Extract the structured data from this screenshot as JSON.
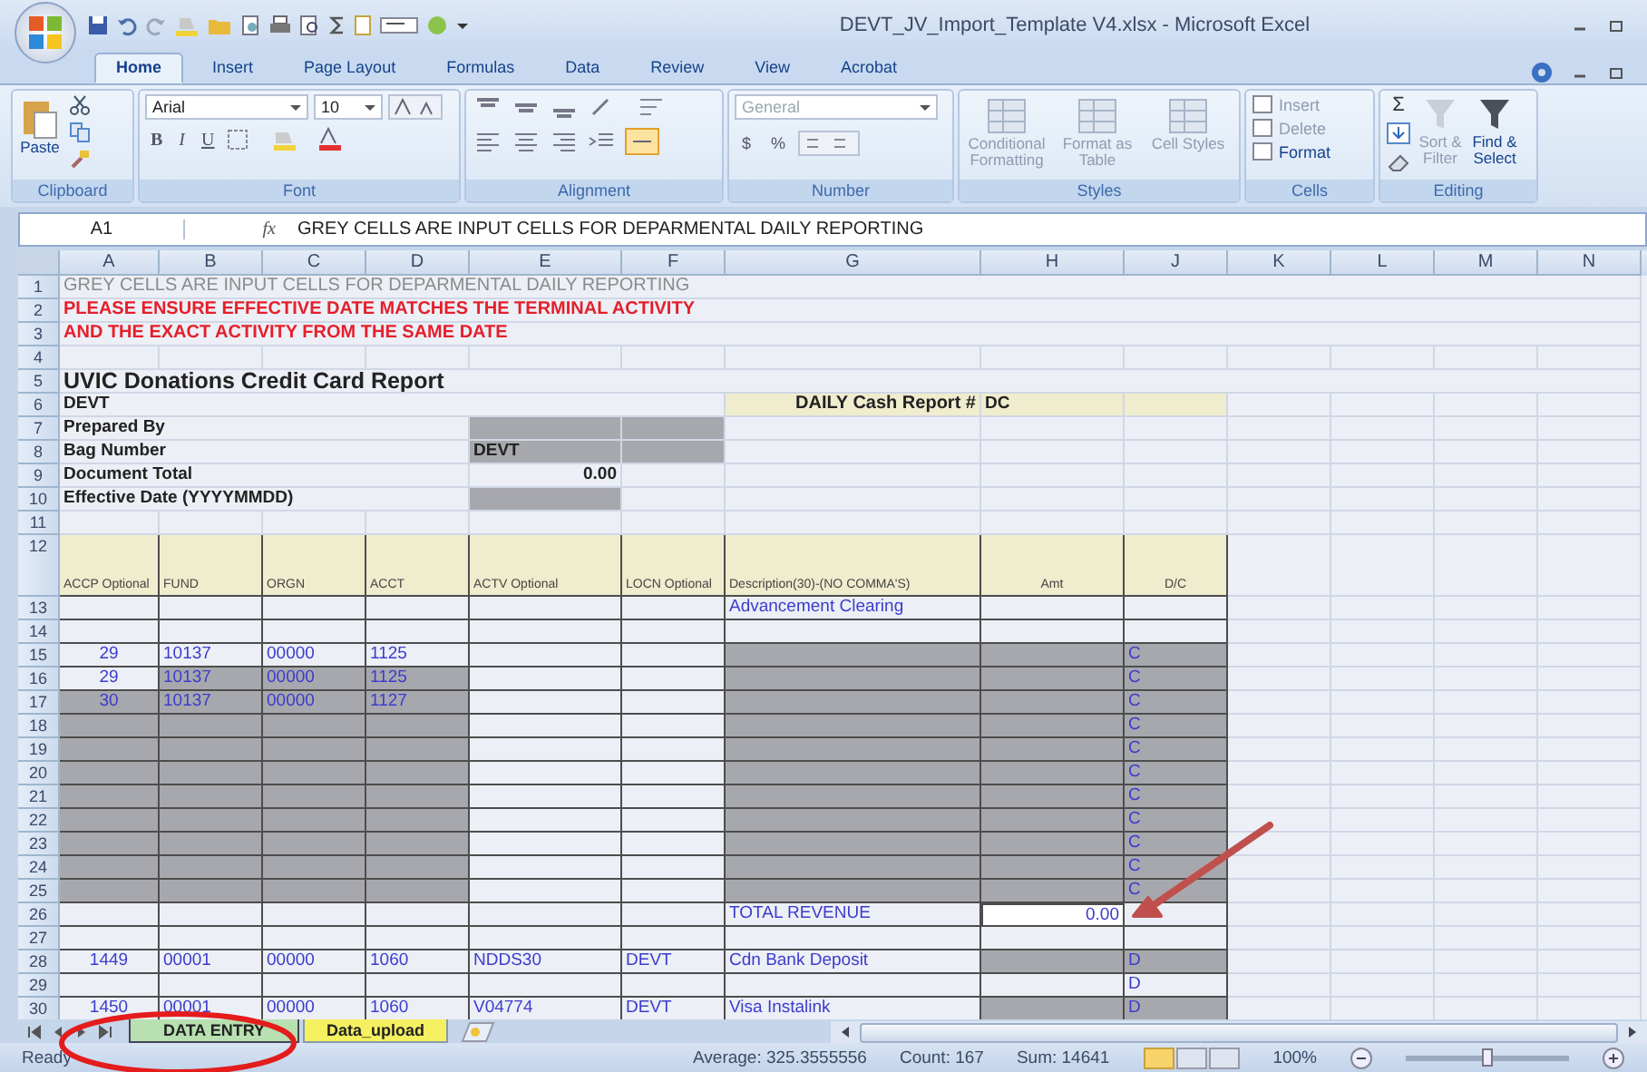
{
  "window": {
    "title": "DEVT_JV_Import_Template V4.xlsx - Microsoft Excel"
  },
  "tabs": [
    {
      "label": "Home",
      "selected": true
    },
    {
      "label": "Insert",
      "selected": false
    },
    {
      "label": "Page Layout",
      "selected": false
    },
    {
      "label": "Formulas",
      "selected": false
    },
    {
      "label": "Data",
      "selected": false
    },
    {
      "label": "Review",
      "selected": false
    },
    {
      "label": "View",
      "selected": false
    },
    {
      "label": "Acrobat",
      "selected": false
    }
  ],
  "ribbon": [
    {
      "kind": "clipboard",
      "label": "Clipboard",
      "paste": "Paste"
    },
    {
      "kind": "font",
      "label": "Font",
      "font": "Arial",
      "size": "10",
      "styles": [
        "B",
        "I",
        "U"
      ]
    },
    {
      "kind": "alignment",
      "label": "Alignment"
    },
    {
      "kind": "number",
      "label": "Number",
      "format": "General",
      "symbols": [
        "$",
        "%"
      ]
    },
    {
      "kind": "styles",
      "label": "Styles",
      "buttons": [
        {
          "label": "Conditional Formatting",
          "disabled": true
        },
        {
          "label": "Format as Table",
          "disabled": true
        },
        {
          "label": "Cell Styles",
          "disabled": true
        }
      ]
    },
    {
      "kind": "cells",
      "label": "Cells",
      "buttons": [
        {
          "label": "Insert",
          "disabled": true
        },
        {
          "label": "Delete",
          "disabled": true
        },
        {
          "label": "Format",
          "disabled": false
        }
      ]
    },
    {
      "kind": "editing",
      "label": "Editing",
      "sigma": "Σ",
      "buttons": [
        {
          "label": "Sort & Filter",
          "disabled": true
        },
        {
          "label": "Find & Select",
          "disabled": false
        }
      ]
    }
  ],
  "formula_bar": {
    "name_box": "A1",
    "fx": "fx",
    "value": "GREY CELLS ARE INPUT CELLS FOR DEPARMENTAL DAILY REPORTING"
  },
  "columns": [
    "A",
    "B",
    "C",
    "D",
    "E",
    "F",
    "G",
    "H",
    "J",
    "K",
    "L",
    "M",
    "N"
  ],
  "rows": [
    {
      "number": "1",
      "cells": [
        {
          "text": "GREY CELLS ARE INPUT CELLS FOR DEPARMENTAL DAILY REPORTING",
          "kind": "note"
        }
      ]
    },
    {
      "number": "2",
      "cells": [
        {
          "text": "PLEASE ENSURE EFFECTIVE DATE MATCHES THE TERMINAL ACTIVITY",
          "kind": "warning"
        }
      ]
    },
    {
      "number": "3",
      "cells": [
        {
          "text": "AND THE EXACT ACTIVITY FROM THE SAME DATE",
          "kind": "warning"
        }
      ]
    },
    {
      "number": "4"
    },
    {
      "number": "5",
      "cells": [
        {
          "text": "UVIC Donations Credit Card Report",
          "kind": "title"
        }
      ]
    },
    {
      "number": "6",
      "cells": [
        {
          "text": "DEVT",
          "kind": "label"
        },
        {},
        {},
        {},
        {},
        {},
        {
          "text": "DAILY Cash Report #",
          "kind": "banner",
          "highlight": true
        },
        {
          "text": "DC",
          "kind": "strong",
          "highlight": true
        },
        {
          "highlight": true
        }
      ]
    },
    {
      "number": "7",
      "cells": [
        {
          "text": "Prepared By",
          "kind": "label"
        },
        {},
        {},
        {},
        {
          "input": true
        },
        {
          "input": true
        }
      ]
    },
    {
      "number": "8",
      "cells": [
        {
          "text": "Bag Number",
          "kind": "label"
        },
        {},
        {},
        {},
        {
          "text": "DEVT",
          "kind": "strong",
          "input": true
        },
        {
          "input": true
        }
      ]
    },
    {
      "number": "9",
      "cells": [
        {
          "text": "Document Total",
          "kind": "label"
        },
        {},
        {},
        {},
        {
          "text": "0.00",
          "kind": "total"
        }
      ]
    },
    {
      "number": "10",
      "cells": [
        {
          "text": "Effective Date (YYYYMMDD)",
          "kind": "label"
        },
        {},
        {},
        {},
        {
          "input": true
        }
      ]
    },
    {
      "number": "11"
    },
    {
      "number": "12",
      "cells": [
        {
          "text": "ACCP Optional",
          "kind": "header"
        },
        {
          "text": "FUND",
          "kind": "header"
        },
        {
          "text": "ORGN",
          "kind": "header"
        },
        {
          "text": "ACCT",
          "kind": "header"
        },
        {
          "text": "ACTV Optional",
          "kind": "header"
        },
        {
          "text": "LOCN Optional",
          "kind": "header"
        },
        {
          "text": "Description(30)-(NO COMMA'S)",
          "kind": "header"
        },
        {
          "text": "Amt",
          "kind": "header-mid"
        },
        {
          "text": "D/C",
          "kind": "header-mid"
        }
      ]
    },
    {
      "number": "13",
      "cells": [
        {},
        {},
        {},
        {},
        {},
        {},
        {
          "text": "Advancement Clearing",
          "kind": "value"
        }
      ]
    },
    {
      "number": "14"
    },
    {
      "number": "15",
      "cells": [
        {
          "text": "29",
          "kind": "id"
        },
        {
          "text": "10137",
          "kind": "value"
        },
        {
          "text": "00000",
          "kind": "value"
        },
        {
          "text": "1125",
          "kind": "value"
        },
        {},
        {},
        {
          "input": true
        },
        {
          "input": true
        },
        {
          "text": "C",
          "kind": "value",
          "input": true
        }
      ]
    },
    {
      "number": "16",
      "cells": [
        {
          "text": "29",
          "kind": "id"
        },
        {
          "text": "10137",
          "kind": "value",
          "input": true
        },
        {
          "text": "00000",
          "kind": "value",
          "input": true
        },
        {
          "text": "1125",
          "kind": "value",
          "input": true
        },
        {},
        {},
        {
          "input": true
        },
        {
          "input": true
        },
        {
          "text": "C",
          "kind": "value",
          "input": true
        }
      ]
    },
    {
      "number": "17",
      "cells": [
        {
          "text": "30",
          "kind": "id",
          "input": true
        },
        {
          "text": "10137",
          "kind": "value",
          "input": true
        },
        {
          "text": "00000",
          "kind": "value",
          "input": true
        },
        {
          "text": "1127",
          "kind": "value",
          "input": true
        },
        {},
        {},
        {
          "input": true
        },
        {
          "input": true
        },
        {
          "text": "C",
          "kind": "value",
          "input": true
        }
      ]
    },
    {
      "number": "18",
      "cells": [
        {
          "input": true
        },
        {
          "input": true
        },
        {
          "input": true
        },
        {
          "input": true
        },
        {},
        {},
        {
          "input": true
        },
        {
          "input": true
        },
        {
          "text": "C",
          "kind": "value",
          "input": true
        }
      ]
    },
    {
      "number": "19",
      "cells": [
        {
          "input": true
        },
        {
          "input": true
        },
        {
          "input": true
        },
        {
          "input": true
        },
        {},
        {},
        {
          "input": true
        },
        {
          "input": true
        },
        {
          "text": "C",
          "kind": "value",
          "input": true
        }
      ]
    },
    {
      "number": "20",
      "cells": [
        {
          "input": true
        },
        {
          "input": true
        },
        {
          "input": true
        },
        {
          "input": true
        },
        {},
        {},
        {
          "input": true
        },
        {
          "input": true
        },
        {
          "text": "C",
          "kind": "value",
          "input": true
        }
      ]
    },
    {
      "number": "21",
      "cells": [
        {
          "input": true
        },
        {
          "input": true
        },
        {
          "input": true
        },
        {
          "input": true
        },
        {},
        {},
        {
          "input": true
        },
        {
          "input": true
        },
        {
          "text": "C",
          "kind": "value",
          "input": true
        }
      ]
    },
    {
      "number": "22",
      "cells": [
        {
          "input": true
        },
        {
          "input": true
        },
        {
          "input": true
        },
        {
          "input": true
        },
        {},
        {},
        {
          "input": true
        },
        {
          "input": true
        },
        {
          "text": "C",
          "kind": "value",
          "input": true
        }
      ]
    },
    {
      "number": "23",
      "cells": [
        {
          "input": true
        },
        {
          "input": true
        },
        {
          "input": true
        },
        {
          "input": true
        },
        {},
        {},
        {
          "input": true
        },
        {
          "input": true
        },
        {
          "text": "C",
          "kind": "value",
          "input": true
        }
      ]
    },
    {
      "number": "24",
      "cells": [
        {
          "input": true
        },
        {
          "input": true
        },
        {
          "input": true
        },
        {
          "input": true
        },
        {},
        {},
        {
          "input": true
        },
        {
          "input": true
        },
        {
          "text": "C",
          "kind": "value",
          "input": true
        }
      ]
    },
    {
      "number": "25",
      "cells": [
        {
          "input": true
        },
        {
          "input": true
        },
        {
          "input": true
        },
        {
          "input": true
        },
        {},
        {},
        {
          "input": true
        },
        {
          "input": true
        },
        {
          "text": "C",
          "kind": "value",
          "input": true
        }
      ]
    },
    {
      "number": "26",
      "cells": [
        {},
        {},
        {},
        {},
        {},
        {},
        {
          "text": "TOTAL REVENUE",
          "kind": "value"
        },
        {
          "text": "0.00",
          "kind": "amount"
        }
      ]
    },
    {
      "number": "27"
    },
    {
      "number": "28",
      "cells": [
        {
          "text": "1449",
          "kind": "id"
        },
        {
          "text": "00001",
          "kind": "value"
        },
        {
          "text": "00000",
          "kind": "value"
        },
        {
          "text": "1060",
          "kind": "value"
        },
        {
          "text": "NDDS30",
          "kind": "value"
        },
        {
          "text": "DEVT",
          "kind": "value"
        },
        {
          "text": "Cdn Bank Deposit",
          "kind": "value"
        },
        {
          "input": true
        },
        {
          "text": "D",
          "kind": "value",
          "input": true
        }
      ]
    },
    {
      "number": "29",
      "cells": [
        {},
        {},
        {},
        {},
        {},
        {},
        {},
        {},
        {
          "text": "D",
          "kind": "value"
        }
      ]
    },
    {
      "number": "30",
      "cells": [
        {
          "text": "1450",
          "kind": "id"
        },
        {
          "text": "00001",
          "kind": "value"
        },
        {
          "text": "00000",
          "kind": "value"
        },
        {
          "text": "1060",
          "kind": "value"
        },
        {
          "text": "V04774",
          "kind": "value"
        },
        {
          "text": "DEVT",
          "kind": "value"
        },
        {
          "text": "Visa Instalink",
          "kind": "value"
        },
        {
          "input": true
        },
        {
          "text": "D",
          "kind": "value",
          "input": true
        }
      ]
    }
  ],
  "sheet_tabs": [
    {
      "label": "DATA ENTRY",
      "selected": true,
      "color": "#b8e0b0"
    },
    {
      "label": "Data_upload",
      "selected": false,
      "color": "#f4f060"
    }
  ],
  "status_bar": {
    "mode": "Ready",
    "average": "Average: 325.3555556",
    "count": "Count: 167",
    "sum": "Sum: 14641",
    "zoom": "100%",
    "zoom_slider": {
      "level": 0.5
    }
  }
}
